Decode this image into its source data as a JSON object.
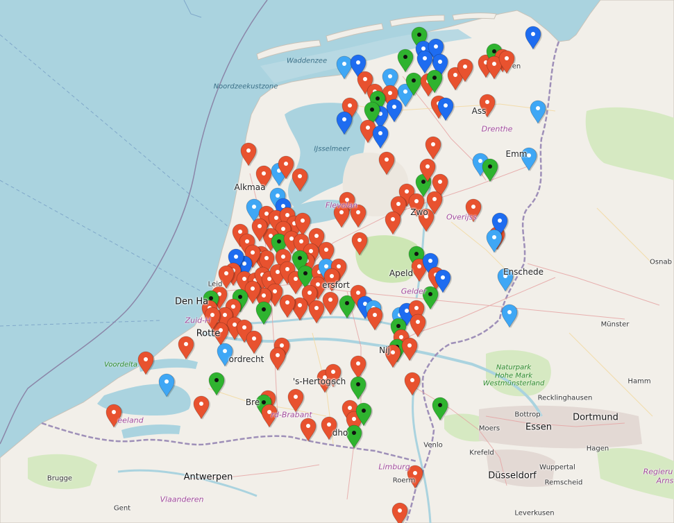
{
  "map": {
    "colors": {
      "sea": "#aad3df",
      "land": "#f2efe9",
      "green": "#cde6b4",
      "border": "#9e8fb8",
      "marker_red": "#e8522f",
      "marker_blue": "#1e6cf0",
      "marker_lightblue": "#3fa7f5",
      "marker_green": "#2fb32f"
    },
    "labels": {
      "sea": [
        {
          "id": "waddenzee",
          "text": "Waddenzee"
        },
        {
          "id": "noordzeekustzone",
          "text": "Noordzeekustzone"
        },
        {
          "id": "ijsselmeer",
          "text": "IJsselmeer"
        }
      ],
      "regions": [
        {
          "id": "drenthe",
          "text": "Drenthe"
        },
        {
          "id": "flevoland",
          "text": "Flevolan"
        },
        {
          "id": "overijssel",
          "text": "Overijss"
        },
        {
          "id": "gelderland",
          "text": "Gelder"
        },
        {
          "id": "zuid-holland",
          "text": "Zuid-H"
        },
        {
          "id": "noord-brabant",
          "text": "rd-Brabant"
        },
        {
          "id": "limburg",
          "text": "Limburg"
        },
        {
          "id": "vlaanderen",
          "text": "Vlaanderen"
        },
        {
          "id": "zeeland",
          "text": "eeland"
        },
        {
          "id": "regierung",
          "text": "Regieru"
        },
        {
          "id": "arns",
          "text": "Arns"
        }
      ],
      "nature": [
        {
          "id": "voordelta",
          "text": "Voordelta"
        },
        {
          "id": "naturpark1",
          "text": "Naturpark"
        },
        {
          "id": "naturpark2",
          "text": "Hohe Mark"
        },
        {
          "id": "naturpark3",
          "text": "Westmünsterland"
        }
      ],
      "cities": [
        {
          "id": "alkmaar",
          "text": "Alkmaa"
        },
        {
          "id": "den-haag",
          "text": "Den Ha"
        },
        {
          "id": "leiden",
          "text": "Leid"
        },
        {
          "id": "rotterdam",
          "text": "Rotte"
        },
        {
          "id": "dordrecht",
          "text": "ordrecht"
        },
        {
          "id": "s-hertogenbosch",
          "text": "'s-Hertoge"
        },
        {
          "id": "bosch",
          "text": "sch"
        },
        {
          "id": "breda",
          "text": "Bre"
        },
        {
          "id": "eindhoven",
          "text": "dho"
        },
        {
          "id": "venlo",
          "text": "Venlo"
        },
        {
          "id": "roermond",
          "text": "Roerm"
        },
        {
          "id": "nijmegen",
          "text": "Nij"
        },
        {
          "id": "apeldoorn",
          "text": "Apeld"
        },
        {
          "id": "zwolle",
          "text": "Zwo"
        },
        {
          "id": "enschede",
          "text": "Enschede"
        },
        {
          "id": "emmen",
          "text": "Emm"
        },
        {
          "id": "assen",
          "text": "Ass"
        },
        {
          "id": "amersfoort",
          "text": "ersfort"
        },
        {
          "id": "gent",
          "text": "Gent"
        },
        {
          "id": "brugge",
          "text": "Brugge"
        },
        {
          "id": "antwerpen",
          "text": "Antwerpen"
        },
        {
          "id": "dusseldorf",
          "text": "Düsseldorf"
        },
        {
          "id": "krefeld",
          "text": "Krefeld"
        },
        {
          "id": "moers",
          "text": "Moers"
        },
        {
          "id": "bottrop",
          "text": "Bottrop"
        },
        {
          "id": "essen",
          "text": "Essen"
        },
        {
          "id": "dortmund",
          "text": "Dortmund"
        },
        {
          "id": "hagen",
          "text": "Hagen"
        },
        {
          "id": "hamm",
          "text": "Hamm"
        },
        {
          "id": "munster",
          "text": "Münster"
        },
        {
          "id": "osnabruck",
          "text": "Osnab"
        },
        {
          "id": "recklinghausen",
          "text": "Recklinghausen"
        },
        {
          "id": "wuppertal",
          "text": "Wuppertal"
        },
        {
          "id": "remscheid",
          "text": "Remscheid"
        },
        {
          "id": "leverkusen",
          "text": "Leverkusen"
        },
        {
          "id": "groningen-en",
          "text": "en"
        }
      ]
    }
  }
}
